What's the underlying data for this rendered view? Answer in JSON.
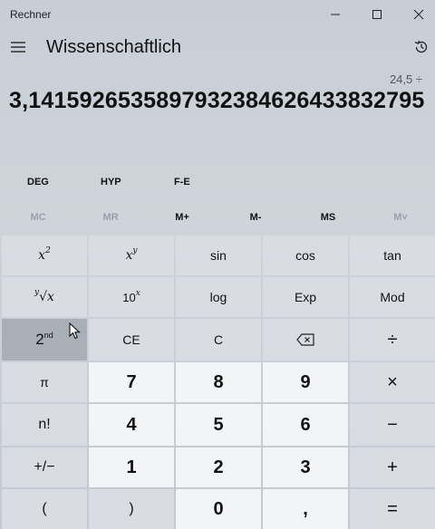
{
  "window": {
    "title": "Rechner",
    "controls": [
      "minimize",
      "maximize",
      "close"
    ]
  },
  "header": {
    "mode_title": "Wissenschaftlich"
  },
  "display": {
    "expression": "24,5 ÷",
    "result": "3,1415926535897932384626433832795"
  },
  "mode_buttons": [
    "DEG",
    "HYP",
    "F-E"
  ],
  "memory_buttons": [
    {
      "label": "MC",
      "enabled": false
    },
    {
      "label": "MR",
      "enabled": false
    },
    {
      "label": "M+",
      "enabled": true
    },
    {
      "label": "M-",
      "enabled": true
    },
    {
      "label": "MS",
      "enabled": true
    },
    {
      "label": "M˅",
      "enabled": false
    }
  ],
  "keys": {
    "x_squared": {
      "base": "x",
      "exp": "2"
    },
    "x_power_y": {
      "base": "x",
      "exp": "y"
    },
    "sin": "sin",
    "cos": "cos",
    "tan": "tan",
    "yroot_x": {
      "index": "y",
      "sym": "√x"
    },
    "ten_power_x": {
      "base": "10",
      "exp": "x"
    },
    "log": "log",
    "exp": "Exp",
    "mod": "Mod",
    "second": {
      "base": "2",
      "exp": "nd"
    },
    "ce": "CE",
    "c": "C",
    "pi": "π",
    "seven": "7",
    "eight": "8",
    "nine": "9",
    "factorial": "n!",
    "four": "4",
    "five": "5",
    "six": "6",
    "negate": "+/−",
    "one": "1",
    "two": "2",
    "three": "3",
    "open_paren": "(",
    "close_paren": ")",
    "zero": "0",
    "decimal": ",",
    "divide": "÷",
    "multiply": "×",
    "minus": "−",
    "plus": "+",
    "equals": "="
  },
  "icons": {
    "menu": "hamburger-icon",
    "history": "history-icon",
    "backspace": "backspace-icon",
    "cursor": "mouse-pointer-icon"
  },
  "colors": {
    "function_key": "#d9dde3",
    "number_key": "#f3f4f6",
    "hover_key": "#a9afb7"
  }
}
